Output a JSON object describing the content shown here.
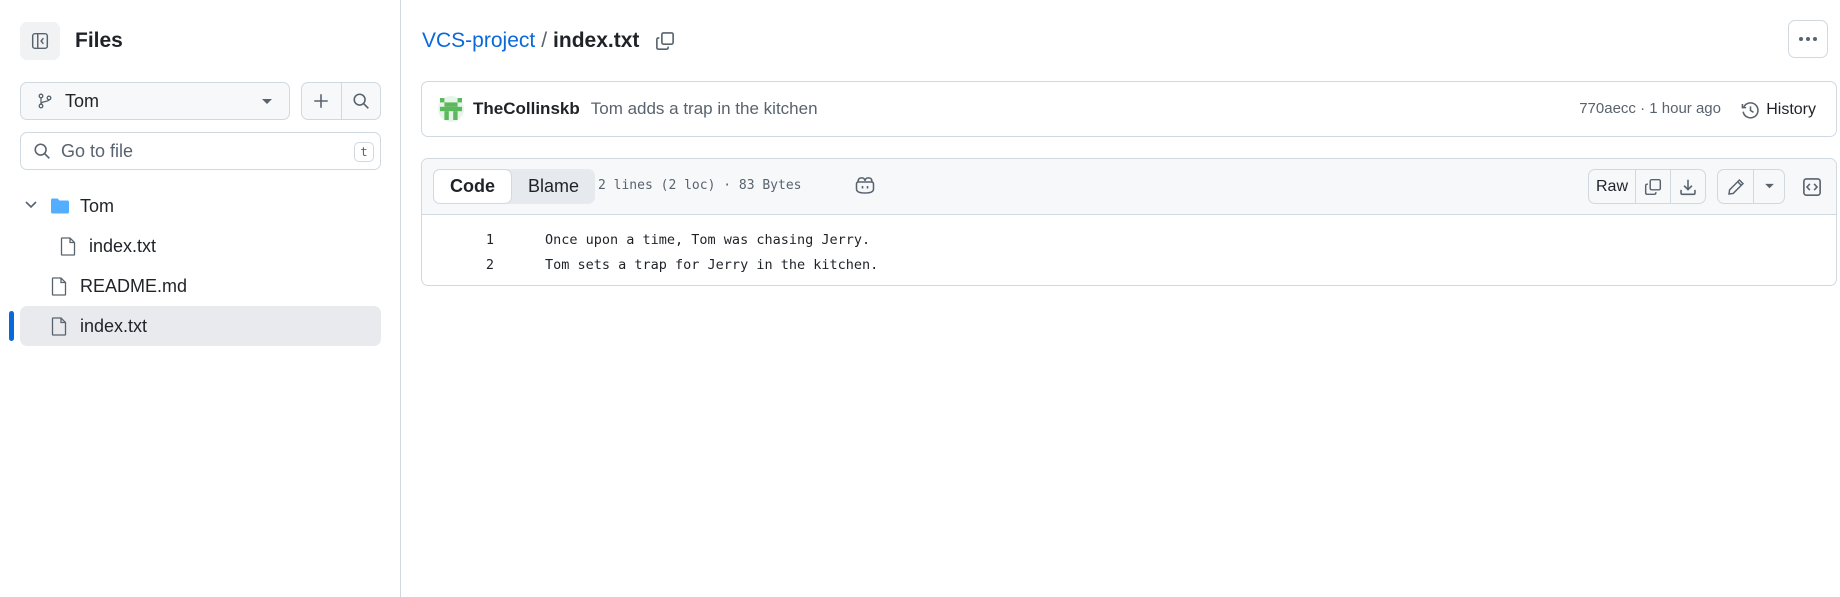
{
  "sidebar": {
    "title": "Files",
    "branch": "Tom",
    "search_placeholder": "Go to file",
    "search_shortcut": "t",
    "tree": [
      {
        "label": "Tom",
        "type": "folder",
        "expanded": true
      },
      {
        "label": "index.txt",
        "type": "file"
      },
      {
        "label": "README.md",
        "type": "file"
      },
      {
        "label": "index.txt",
        "type": "file",
        "active": true
      }
    ]
  },
  "breadcrumb": {
    "repo": "VCS-project",
    "separator": "/",
    "file": "index.txt"
  },
  "commit": {
    "author": "TheCollinskb",
    "message": "Tom adds a trap in the kitchen",
    "meta": "770aecc · 1 hour ago",
    "history_label": "History"
  },
  "file_view": {
    "tabs": [
      "Code",
      "Blame"
    ],
    "selected_tab": "Code",
    "info": "2 lines (2 loc) · 83 Bytes",
    "raw_label": "Raw",
    "lines": [
      {
        "number": "1",
        "text": "Once upon a time, Tom was chasing Jerry."
      },
      {
        "number": "2",
        "text": "Tom sets a trap for Jerry in the kitchen."
      }
    ]
  },
  "colors": {
    "accent": "#0969da",
    "folder": "#54aeff",
    "border": "#d1d9e0",
    "muted": "#59636e"
  }
}
